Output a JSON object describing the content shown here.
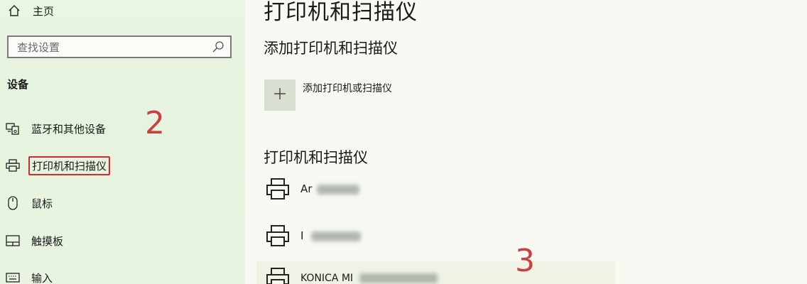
{
  "sidebar": {
    "home_label": "主页",
    "search_placeholder": "查找设置",
    "section_title": "设备",
    "items": [
      {
        "label": "蓝牙和其他设备",
        "icon": "bluetooth-devices-icon"
      },
      {
        "label": "打印机和扫描仪",
        "icon": "printer-icon",
        "selected": true
      },
      {
        "label": "鼠标",
        "icon": "mouse-icon"
      },
      {
        "label": "触摸板",
        "icon": "touchpad-icon"
      },
      {
        "label": "输入",
        "icon": "keyboard-icon"
      }
    ]
  },
  "annotations": {
    "step2": "2",
    "step3": "3",
    "color": "#c8403f"
  },
  "main": {
    "title": "打印机和扫描仪",
    "add_section_title": "添加打印机和扫描仪",
    "add_button_label": "添加打印机或扫描仪",
    "list_title": "打印机和扫描仪",
    "printers": [
      {
        "name": "Ar"
      },
      {
        "name": "I"
      },
      {
        "name": "KONICA MI"
      }
    ]
  }
}
